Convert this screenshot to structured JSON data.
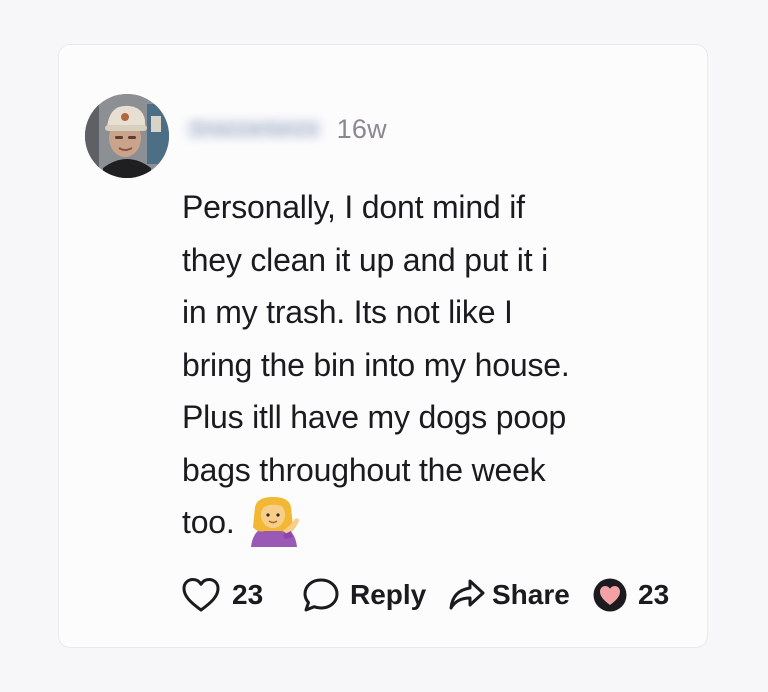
{
  "comment": {
    "username": "Snazzantanzs",
    "timestamp": "16w",
    "lines": [
      "Personally, I dont mind if",
      "they clean it up and put it i",
      "in my trash. Its not like I",
      "bring the bin into my house.",
      "Plus itll have my dogs poop",
      "bags throughout the week",
      "too."
    ],
    "emoji": "person-tipping-hand-emoji"
  },
  "actions": {
    "like_count": "23",
    "reply_label": "Reply",
    "share_label": "Share",
    "reaction_count": "23"
  },
  "colors": {
    "background": "#f7f6f8",
    "card": "#fdfcfd",
    "text": "#1b1b1f",
    "timestamp": "#8a8792",
    "reaction_heart": "#f3a1a4"
  },
  "icons": {
    "like": "heart-outline-icon",
    "reply": "speech-bubble-icon",
    "share": "share-arrow-icon",
    "reaction": "heart-filled-icon"
  }
}
